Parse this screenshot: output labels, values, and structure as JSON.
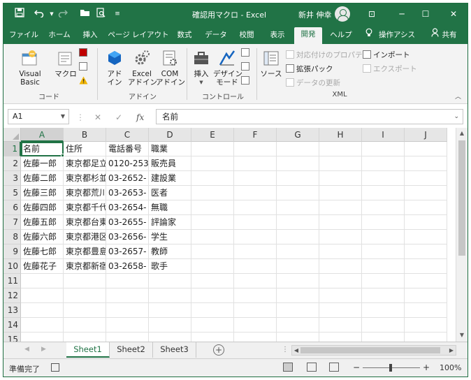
{
  "titlebar": {
    "document_title": "確認用マクロ  -  Excel",
    "user_name": "新井 伸幸",
    "icons": [
      "save-icon",
      "undo-icon",
      "redo-icon",
      "open-folder-icon",
      "print-preview-icon",
      "customize-qat-icon"
    ],
    "window_buttons": {
      "ribbon_display": "⊡",
      "minimize": "─",
      "maximize": "☐",
      "close": "✕"
    }
  },
  "tabs": [
    {
      "label": "ファイル"
    },
    {
      "label": "ホーム"
    },
    {
      "label": "挿入"
    },
    {
      "label": "ページ レイアウト"
    },
    {
      "label": "数式"
    },
    {
      "label": "データ"
    },
    {
      "label": "校閲"
    },
    {
      "label": "表示"
    },
    {
      "label": "開発",
      "active": true
    },
    {
      "label": "ヘルプ"
    },
    {
      "label": "操作アシス"
    },
    {
      "label": "共有"
    }
  ],
  "ribbon": {
    "code_group": {
      "label": "コード",
      "visual_basic": "Visual Basic",
      "macro": "マクロ"
    },
    "addin_group": {
      "label": "アドイン",
      "addin": "アド\nイン",
      "excel_addin": "Excel\nアドイン",
      "com_addin": "COM\nアドイン"
    },
    "controls_group": {
      "label": "コントロール",
      "insert": "挿入",
      "design_mode": "デザイン\nモード"
    },
    "xml_group": {
      "label": "XML",
      "source": "ソース",
      "map_properties": "対応付けのプロパティ",
      "expansion_pack": "拡張パック",
      "refresh_data": "データの更新",
      "import": "インポート",
      "export": "エクスポート"
    }
  },
  "formula_bar": {
    "name_box": "A1",
    "cancel_glyph": "✕",
    "enter_glyph": "✓",
    "fx_glyph": "fx",
    "content": "名前"
  },
  "grid": {
    "columns": [
      "A",
      "B",
      "C",
      "D",
      "E",
      "F",
      "G",
      "H",
      "I",
      "J"
    ],
    "row_numbers": [
      "1",
      "2",
      "3",
      "5",
      "6",
      "7",
      "8",
      "9",
      "10",
      "11",
      "12",
      "13",
      "14",
      "15"
    ],
    "rows": [
      [
        "名前",
        "住所",
        "電話番号",
        "職業"
      ],
      [
        "佐藤一郎",
        "東京都足立",
        "0120-253-",
        "販売員"
      ],
      [
        "佐藤二郎",
        "東京都杉並",
        "03-2652-",
        "建設業"
      ],
      [
        "佐藤三郎",
        "東京都荒川",
        "03-2653-",
        "医者"
      ],
      [
        "佐藤四郎",
        "東京都千代",
        "03-2654-",
        "無職"
      ],
      [
        "佐藤五郎",
        "東京都台東",
        "03-2655-",
        "評論家"
      ],
      [
        "佐藤六郎",
        "東京都港区",
        "03-2656-",
        "学生"
      ],
      [
        "佐藤七郎",
        "東京都豊島",
        "03-2657-",
        "教師"
      ],
      [
        "佐藤花子",
        "東京都新宿",
        "03-2658-",
        "歌手"
      ],
      [
        "",
        "",
        "",
        ""
      ],
      [
        "",
        "",
        "",
        ""
      ],
      [
        "",
        "",
        "",
        ""
      ],
      [
        "",
        "",
        "",
        ""
      ],
      [
        "",
        "",
        "",
        ""
      ]
    ]
  },
  "sheets": [
    {
      "label": "Sheet1",
      "active": true
    },
    {
      "label": "Sheet2"
    },
    {
      "label": "Sheet3"
    }
  ],
  "statusbar": {
    "status": "準備完了",
    "zoom_minus": "−",
    "zoom_plus": "+",
    "zoom": "100%"
  },
  "colors": {
    "accent": "#217346",
    "ribbon_bg": "#f3f3f3",
    "header_bg": "#e6e6e6"
  }
}
